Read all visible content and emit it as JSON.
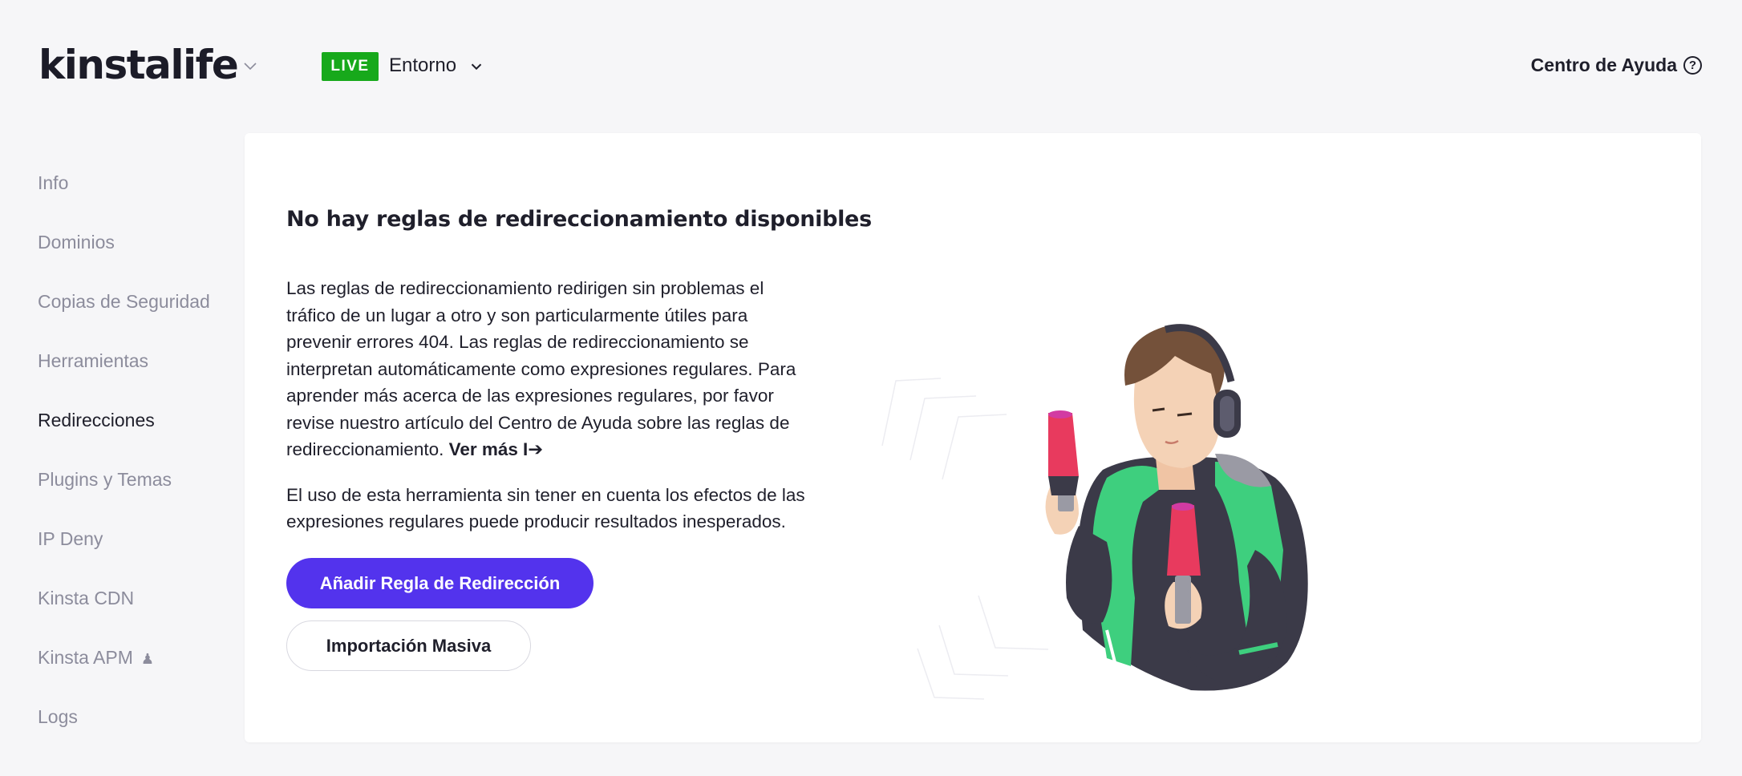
{
  "header": {
    "logo_text": "kinstalife",
    "environment": {
      "badge": "LIVE",
      "badge_color": "#17a91b",
      "label": "Entorno"
    },
    "help_label": "Centro de Ayuda",
    "help_icon_glyph": "?"
  },
  "sidebar": {
    "items": [
      {
        "label": "Info",
        "active": false
      },
      {
        "label": "Dominios",
        "active": false
      },
      {
        "label": "Copias de Seguridad",
        "active": false
      },
      {
        "label": "Herramientas",
        "active": false
      },
      {
        "label": "Redirecciones",
        "active": true
      },
      {
        "label": "Plugins y Temas",
        "active": false
      },
      {
        "label": "IP Deny",
        "active": false
      },
      {
        "label": "Kinsta CDN",
        "active": false
      },
      {
        "label": "Kinsta APM",
        "active": false,
        "icon": "flask-icon",
        "icon_glyph": "♟"
      },
      {
        "label": "Logs",
        "active": false
      }
    ]
  },
  "main": {
    "title": "No hay reglas de redireccionamiento disponibles",
    "paragraph1": "Las reglas de redireccionamiento redirigen sin problemas el tráfico de un lugar a otro y son particularmente útiles para prevenir errores 404. Las reglas de redireccionamiento se interpretan automáticamente como expresiones regulares. Para aprender más acerca de las expresiones regulares, por favor revise nuestro artículo del Centro de Ayuda sobre las reglas de redireccionamiento.",
    "more_link": "Ver más",
    "more_arrow": "I➔",
    "paragraph2": "El uso de esta herramienta sin tener en cuenta los efectos de las expresiones regulares puede producir resultados inesperados.",
    "primary_button": "Añadir Regla de Redirección",
    "secondary_button": "Importación Masiva",
    "accent_color": "#5333ed"
  }
}
